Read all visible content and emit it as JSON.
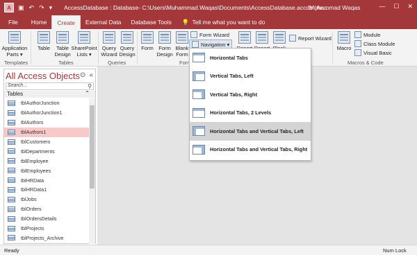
{
  "titlebar": {
    "app_icon": "A",
    "undo": "↶",
    "redo": "↷",
    "qat_more": "▾",
    "title": "AccessDatabase : Database- C:\\Users\\Muhammad.Waqas\\Documents\\AccessDatabase.accdb (Ac...",
    "user": "Muhammad Waqas",
    "minimize": "—",
    "maximize": "☐",
    "close": "✕"
  },
  "tabs": [
    "File",
    "Home",
    "Create",
    "External Data",
    "Database Tools"
  ],
  "tell_me": "Tell me what you want to do",
  "ribbon": {
    "application_parts": "Application Parts ▾",
    "table": "Table",
    "table_design": "Table Design",
    "sharepoint_lists": "SharePoint Lists ▾",
    "query_wizard": "Query Wizard",
    "query_design": "Query Design",
    "form": "Form",
    "form_design": "Form Design",
    "blank_form": "Blank Form",
    "form_wizard": "Form Wizard",
    "navigation": "Navigation ▾",
    "report": "Report",
    "report2": "Report",
    "blank": "Blank",
    "report_wizard": "Report Wizard",
    "macro": "Macro",
    "module": "Module",
    "class_module": "Class Module",
    "visual_basic": "Visual Basic",
    "groups": {
      "templates": "Templates",
      "tables": "Tables",
      "queries": "Queries",
      "forms": "Form",
      "macros_code": "Macros & Code"
    }
  },
  "nav": {
    "title": "All Access Objects",
    "dropdown_glyph": "⊙",
    "collapse_glyph": "«",
    "search_placeholder": "Search...",
    "search_icon_glyph": "⚲",
    "section": "Tables",
    "section_chevron": "⌃",
    "items": [
      "tblAuthorJunction",
      "tblAuthorJunction1",
      "tblAuthors",
      "tblAuthors1",
      "tblCustomers",
      "tblDepartments",
      "tblEmployee",
      "tblEmployees",
      "tblHRData",
      "tblHRData1",
      "tblJobs",
      "tblOrders",
      "tblOrdersDetails",
      "tblProjects",
      "tblProjects_Archive"
    ],
    "selected_index": 3
  },
  "navigation_menu": [
    {
      "label": "Horizontal Tabs",
      "icon": "horizontal-tabs-icon"
    },
    {
      "label": "Vertical Tabs, Left",
      "icon": "vertical-tabs-left-icon"
    },
    {
      "label": "Vertical Tabs, Right",
      "icon": "vertical-tabs-right-icon"
    },
    {
      "label": "Horizontal Tabs, 2 Levels",
      "icon": "horizontal-tabs-2-levels-icon"
    },
    {
      "label": "Horizontal Tabs and Vertical Tabs, Left",
      "icon": "horizontal-vertical-tabs-left-icon"
    },
    {
      "label": "Horizontal Tabs and Vertical Tabs, Right",
      "icon": "horizontal-vertical-tabs-right-icon"
    }
  ],
  "status": {
    "left": "Ready",
    "right": "Num Lock"
  },
  "colors": {
    "accent": "#a4373a",
    "selected_row": "#f7c9c9",
    "hover_row": "#d4d4d4"
  }
}
